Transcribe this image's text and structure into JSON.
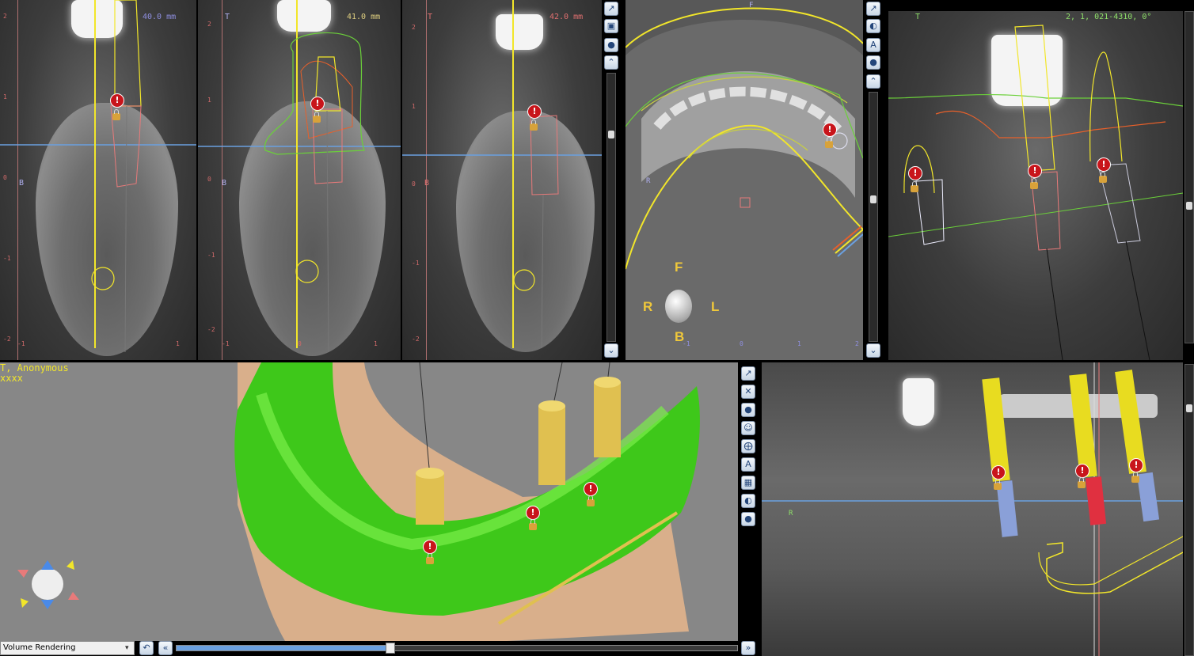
{
  "patient": {
    "name_line": "T, Anonymous",
    "id_line": "xxxx"
  },
  "cross_sections": [
    {
      "thickness": "40.0 mm",
      "marker_top": "T",
      "marker_mid": "B"
    },
    {
      "thickness": "41.0 mm",
      "marker_top": "T",
      "marker_mid": "B"
    },
    {
      "thickness": "42.0 mm",
      "marker_top": "T",
      "marker_mid": "B"
    }
  ],
  "ruler_ticks": [
    "2",
    "1",
    "0",
    "-1",
    "-2"
  ],
  "ruler_x_ticks": [
    "-1",
    "0",
    "1"
  ],
  "axial": {
    "orientation": {
      "front": "F",
      "right": "R",
      "left": "L",
      "back": "B"
    },
    "top_letter": "F",
    "side_letter": "R",
    "x_ticks": [
      "-1",
      "0",
      "1",
      "2"
    ]
  },
  "tangential": {
    "label": "2, 1, 021-4310, 0°",
    "marker": "T"
  },
  "panoramic": {
    "marker": "R"
  },
  "volume_rendering": {
    "mode_select": "Volume Rendering"
  },
  "warning_symbol": "!",
  "colors": {
    "accent_yellow": "#f2e62a",
    "guide_green": "#6bd03a",
    "implant_red": "#e87a7a",
    "hline_blue": "#6aa0e0",
    "ruler_red": "#d06a6a"
  }
}
